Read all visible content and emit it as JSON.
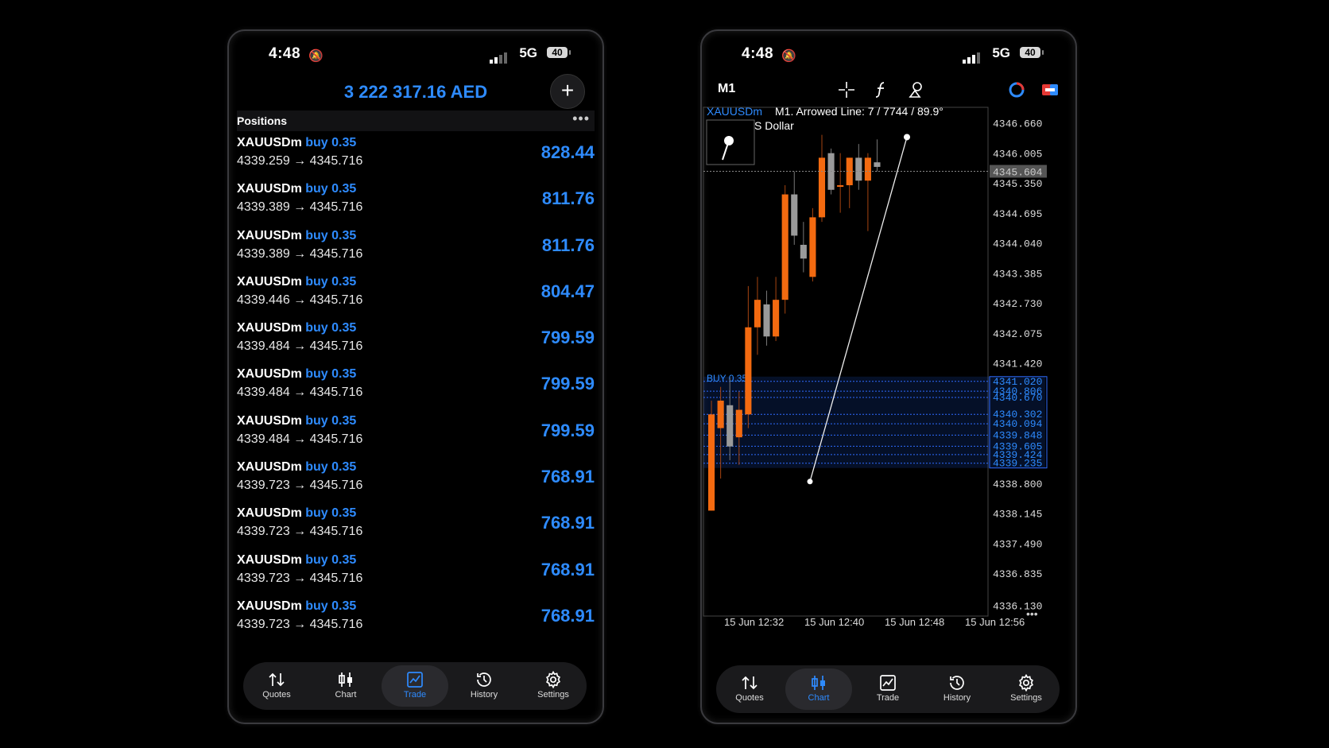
{
  "status": {
    "time": "4:48",
    "network": "5G",
    "battery": "40"
  },
  "left": {
    "balance": "3 222 317.16 AED",
    "positions_title": "Positions",
    "more": "•••",
    "positions": [
      {
        "symbol": "XAUUSDm",
        "side": "buy 0.35",
        "prices": "4339.259 → 4345.716",
        "profit": "828.44"
      },
      {
        "symbol": "XAUUSDm",
        "side": "buy 0.35",
        "prices": "4339.389 → 4345.716",
        "profit": "811.76"
      },
      {
        "symbol": "XAUUSDm",
        "side": "buy 0.35",
        "prices": "4339.389 → 4345.716",
        "profit": "811.76"
      },
      {
        "symbol": "XAUUSDm",
        "side": "buy 0.35",
        "prices": "4339.446 → 4345.716",
        "profit": "804.47"
      },
      {
        "symbol": "XAUUSDm",
        "side": "buy 0.35",
        "prices": "4339.484 → 4345.716",
        "profit": "799.59"
      },
      {
        "symbol": "XAUUSDm",
        "side": "buy 0.35",
        "prices": "4339.484 → 4345.716",
        "profit": "799.59"
      },
      {
        "symbol": "XAUUSDm",
        "side": "buy 0.35",
        "prices": "4339.484 → 4345.716",
        "profit": "799.59"
      },
      {
        "symbol": "XAUUSDm",
        "side": "buy 0.35",
        "prices": "4339.723 → 4345.716",
        "profit": "768.91"
      },
      {
        "symbol": "XAUUSDm",
        "side": "buy 0.35",
        "prices": "4339.723 → 4345.716",
        "profit": "768.91"
      },
      {
        "symbol": "XAUUSDm",
        "side": "buy 0.35",
        "prices": "4339.723 → 4345.716",
        "profit": "768.91"
      },
      {
        "symbol": "XAUUSDm",
        "side": "buy 0.35",
        "prices": "4339.723 → 4345.716",
        "profit": "768.91"
      }
    ],
    "tabs": [
      {
        "label": "Quotes",
        "icon": "quotes-icon"
      },
      {
        "label": "Chart",
        "icon": "candles-icon"
      },
      {
        "label": "Trade",
        "icon": "trade-icon",
        "active": true
      },
      {
        "label": "History",
        "icon": "history-icon"
      },
      {
        "label": "Settings",
        "icon": "gear-icon"
      }
    ]
  },
  "right": {
    "timeframe": "M1",
    "chart_info": "M1. Arrowed Line: 7 / 7744 / 89.9°",
    "symbol": "XAUUSDm",
    "symbol_desc": "S Dollar",
    "current_price": "4345.604",
    "buy_label": "BUY 0.35",
    "tabs": [
      {
        "label": "Quotes",
        "icon": "quotes-icon"
      },
      {
        "label": "Chart",
        "icon": "candles-icon",
        "active": true
      },
      {
        "label": "Trade",
        "icon": "trade-icon"
      },
      {
        "label": "History",
        "icon": "history-icon"
      },
      {
        "label": "Settings",
        "icon": "gear-icon"
      }
    ],
    "colors": {
      "bull": "#f36a10",
      "bear": "#9a9a9a",
      "accent": "#2e8bff"
    }
  },
  "chart_data": {
    "type": "candlestick",
    "y_ticks": [
      "4346.660",
      "4346.005",
      "4345.350",
      "4344.695",
      "4344.040",
      "4343.385",
      "4342.730",
      "4342.075",
      "4341.420",
      "4338.800",
      "4338.145",
      "4337.490",
      "4336.835",
      "4336.130"
    ],
    "x_ticks": [
      "15 Jun 12:32",
      "15 Jun 12:40",
      "15 Jun 12:48",
      "15 Jun 12:56"
    ],
    "order_levels": [
      "4341.020",
      "4340.806",
      "4340.670",
      "4340.302",
      "4340.094",
      "4339.848",
      "4339.605",
      "4339.424",
      "4339.235"
    ],
    "ylim": [
      4335.9,
      4347.0
    ],
    "candles": [
      {
        "o": 4338.2,
        "h": 4340.6,
        "l": 4338.2,
        "c": 4340.3
      },
      {
        "o": 4340.0,
        "h": 4340.9,
        "l": 4338.9,
        "c": 4340.6
      },
      {
        "o": 4340.5,
        "h": 4341.1,
        "l": 4339.3,
        "c": 4339.6
      },
      {
        "o": 4339.8,
        "h": 4340.8,
        "l": 4339.2,
        "c": 4340.4
      },
      {
        "o": 4340.3,
        "h": 4343.1,
        "l": 4340.0,
        "c": 4342.2
      },
      {
        "o": 4342.2,
        "h": 4343.3,
        "l": 4341.6,
        "c": 4342.8
      },
      {
        "o": 4342.7,
        "h": 4343.0,
        "l": 4341.8,
        "c": 4342.0
      },
      {
        "o": 4342.0,
        "h": 4343.3,
        "l": 4341.9,
        "c": 4342.8
      },
      {
        "o": 4342.8,
        "h": 4345.3,
        "l": 4342.5,
        "c": 4345.1
      },
      {
        "o": 4345.1,
        "h": 4345.6,
        "l": 4344.0,
        "c": 4344.2
      },
      {
        "o": 4344.0,
        "h": 4344.5,
        "l": 4343.4,
        "c": 4343.7
      },
      {
        "o": 4343.3,
        "h": 4344.8,
        "l": 4343.2,
        "c": 4344.6
      },
      {
        "o": 4344.6,
        "h": 4346.4,
        "l": 4344.5,
        "c": 4345.9
      },
      {
        "o": 4346.0,
        "h": 4346.1,
        "l": 4345.1,
        "c": 4345.2
      },
      {
        "o": 4345.3,
        "h": 4346.0,
        "l": 4344.7,
        "c": 4345.3
      },
      {
        "o": 4345.3,
        "h": 4345.9,
        "l": 4344.8,
        "c": 4345.9
      },
      {
        "o": 4345.9,
        "h": 4346.2,
        "l": 4345.2,
        "c": 4345.4
      },
      {
        "o": 4345.4,
        "h": 4346.0,
        "l": 4344.3,
        "c": 4345.9
      },
      {
        "o": 4345.8,
        "h": 4346.3,
        "l": 4345.6,
        "c": 4345.7
      }
    ]
  }
}
